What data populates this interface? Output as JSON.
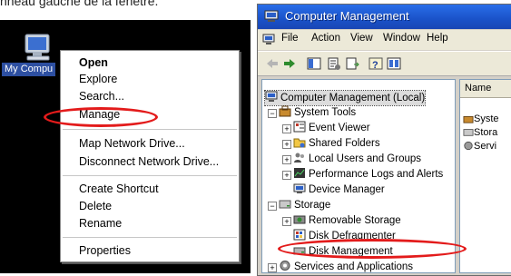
{
  "caption": "nneau gauche de la fenêtre.",
  "desktop": {
    "icon_label": "My Compu",
    "context_menu": [
      {
        "label": "Open",
        "bold": true
      },
      {
        "label": "Explore"
      },
      {
        "label": "Search..."
      },
      {
        "label": "Manage",
        "highlighted_ring": true
      },
      {
        "label": "Map Network Drive..."
      },
      {
        "label": "Disconnect Network Drive..."
      },
      {
        "label": "Create Shortcut"
      },
      {
        "label": "Delete"
      },
      {
        "label": "Rename"
      },
      {
        "label": "Properties"
      }
    ]
  },
  "window": {
    "title": "Computer Management",
    "menu": [
      "File",
      "Action",
      "View",
      "Window",
      "Help"
    ],
    "tree": {
      "root": "Computer Management (Local)",
      "system_tools": "System Tools",
      "event_viewer": "Event Viewer",
      "shared_folders": "Shared Folders",
      "local_users": "Local Users and Groups",
      "perf_logs": "Performance Logs and Alerts",
      "device_manager": "Device Manager",
      "storage": "Storage",
      "removable_storage": "Removable Storage",
      "disk_defrag": "Disk Defragmenter",
      "disk_management": "Disk Management",
      "services_apps": "Services and Applications"
    },
    "list_header": "Name",
    "list_items": [
      "Syste",
      "Stora",
      "Servi"
    ]
  },
  "colors": {
    "highlight_ring": "#e31b1b",
    "titlebar": "#1a52c9"
  }
}
